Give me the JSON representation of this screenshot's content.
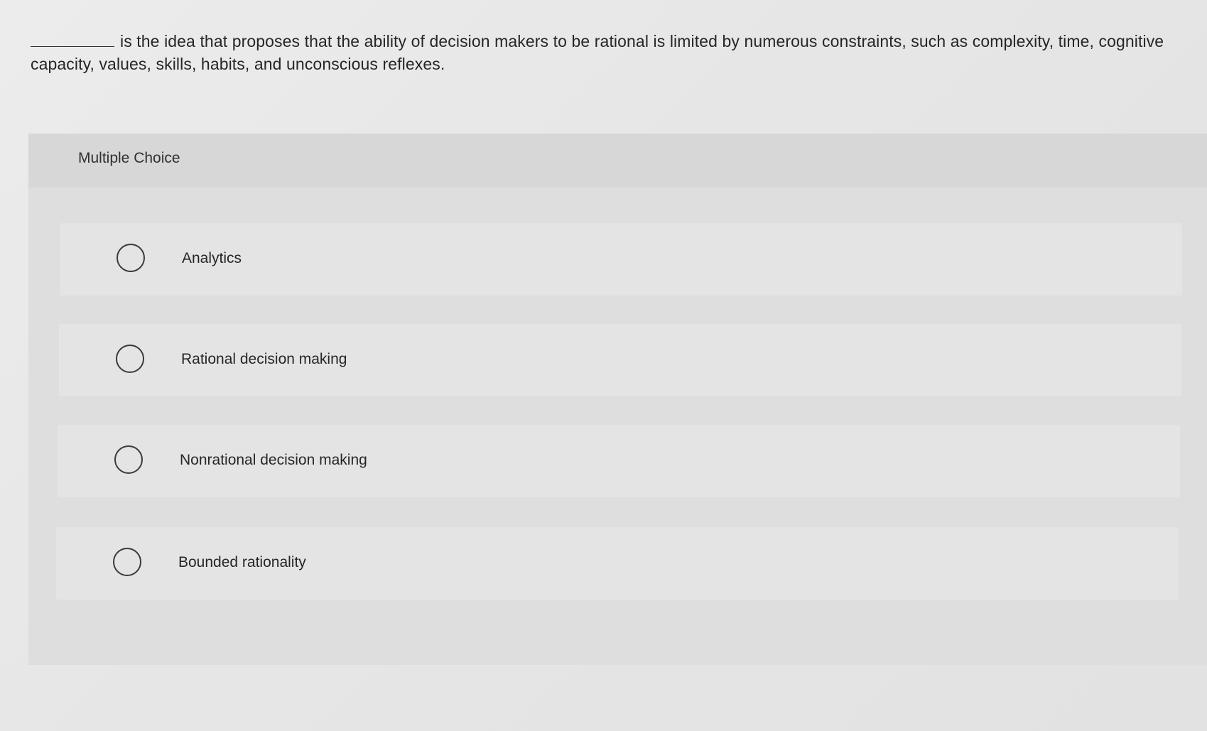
{
  "question": {
    "text": "is the idea that proposes that the ability of decision makers to be rational is limited by numerous constraints, such as complexity, time, cognitive capacity, values, skills, habits, and unconscious reflexes."
  },
  "panel": {
    "title": "Multiple Choice"
  },
  "options": [
    {
      "label": "Analytics",
      "selected": false
    },
    {
      "label": "Rational decision making",
      "selected": false
    },
    {
      "label": "Nonrational decision making",
      "selected": false
    },
    {
      "label": "Bounded rationality",
      "selected": false
    }
  ]
}
